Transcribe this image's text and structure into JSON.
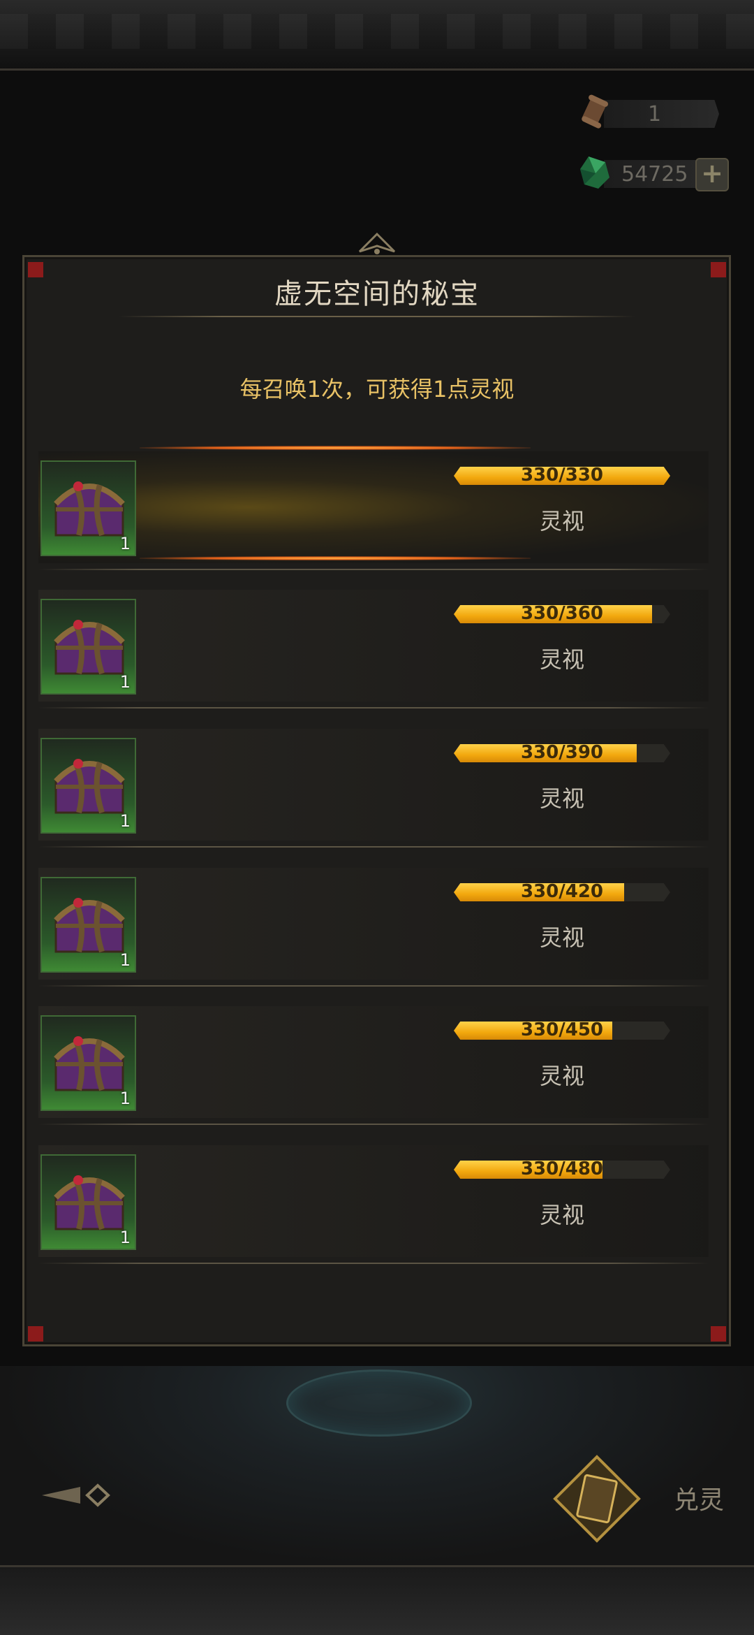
{
  "header": {
    "currencies": [
      {
        "icon": "scroll-icon",
        "value": "1"
      },
      {
        "icon": "green-gem-icon",
        "value": "54725"
      }
    ]
  },
  "panel": {
    "title": "虚无空间的秘宝",
    "subtitle": "每召唤1次，可获得1点灵视",
    "rewards": [
      {
        "count": "1",
        "progress": "330/330",
        "current": 330,
        "max": 330,
        "label": "灵视",
        "highlighted": true
      },
      {
        "count": "1",
        "progress": "330/360",
        "current": 330,
        "max": 360,
        "label": "灵视",
        "highlighted": false
      },
      {
        "count": "1",
        "progress": "330/390",
        "current": 330,
        "max": 390,
        "label": "灵视",
        "highlighted": false
      },
      {
        "count": "1",
        "progress": "330/420",
        "current": 330,
        "max": 420,
        "label": "灵视",
        "highlighted": false
      },
      {
        "count": "1",
        "progress": "330/450",
        "current": 330,
        "max": 450,
        "label": "灵视",
        "highlighted": false
      },
      {
        "count": "1",
        "progress": "330/480",
        "current": 330,
        "max": 480,
        "label": "灵视",
        "highlighted": false
      }
    ]
  },
  "footer": {
    "exchange_label": "兑灵"
  },
  "colors": {
    "accent_gold": "#f2a80e",
    "subtitle": "#e9c266",
    "panel_border": "#4a4436",
    "corner_red": "#8c1b1b"
  }
}
